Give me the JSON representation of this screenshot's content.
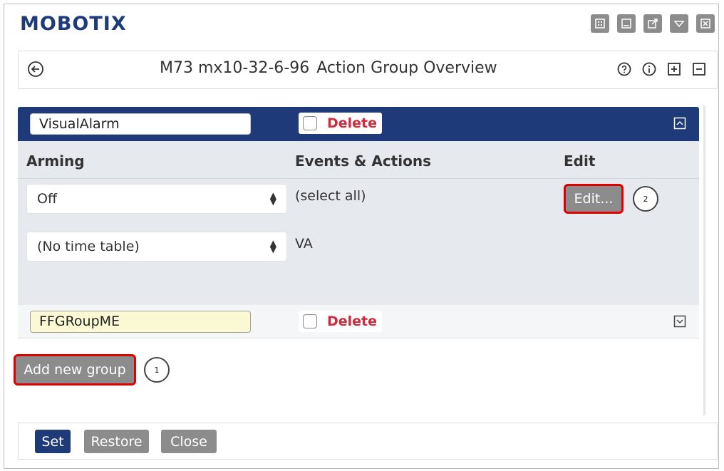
{
  "brand": {
    "logo": "MOBOTIX"
  },
  "window_icons": [
    "view-icon",
    "minimize-icon",
    "popout-icon",
    "dropdown-icon",
    "close-icon"
  ],
  "header": {
    "camera": "M73 mx10-32-6-96",
    "page": "Action Group Overview",
    "icons": [
      "help-icon",
      "info-icon",
      "expand-all-icon",
      "collapse-all-icon"
    ]
  },
  "groups": [
    {
      "name": "VisualAlarm",
      "delete_label": "Delete",
      "expanded": true,
      "columns": {
        "arming": "Arming",
        "events_actions": "Events & Actions",
        "edit": "Edit"
      },
      "arming_value": "Off",
      "time_table_value": "(No time table)",
      "events": [
        "(select all)",
        "VA"
      ],
      "edit_button": "Edit...",
      "edit_callout": "2"
    },
    {
      "name": "FFGRoupME",
      "delete_label": "Delete",
      "expanded": false
    }
  ],
  "add_group": {
    "label": "Add new group",
    "callout": "1"
  },
  "footer": {
    "set": "Set",
    "restore": "Restore",
    "close": "Close"
  },
  "colors": {
    "brand_blue": "#1e3a78",
    "button_grey": "#8c8c8c",
    "delete_red": "#d12a3e",
    "highlight_red": "#e00000",
    "edited_field": "#fbf9d4"
  }
}
